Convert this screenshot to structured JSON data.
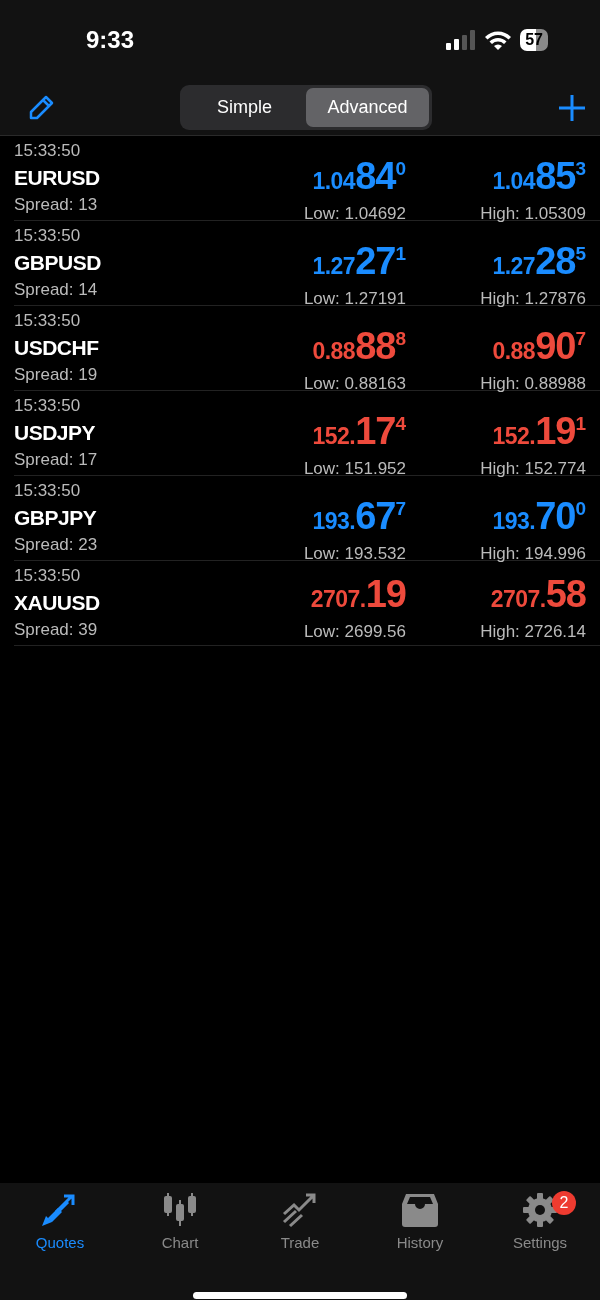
{
  "status_bar": {
    "time": "9:33",
    "battery": "57"
  },
  "header": {
    "segments": [
      {
        "label": "Simple",
        "selected": false
      },
      {
        "label": "Advanced",
        "selected": true
      }
    ]
  },
  "quotes": [
    {
      "time": "15:33:50",
      "symbol": "EURUSD",
      "spread": "Spread: 13",
      "color": "#1a8cff",
      "bid": {
        "prefix": "1.04",
        "big": "84",
        "pip": "0"
      },
      "ask": {
        "prefix": "1.04",
        "big": "85",
        "pip": "3"
      },
      "low": "Low: 1.04692",
      "high": "High: 1.05309"
    },
    {
      "time": "15:33:50",
      "symbol": "GBPUSD",
      "spread": "Spread: 14",
      "color": "#1a8cff",
      "bid": {
        "prefix": "1.27",
        "big": "27",
        "pip": "1"
      },
      "ask": {
        "prefix": "1.27",
        "big": "28",
        "pip": "5"
      },
      "low": "Low: 1.27191",
      "high": "High: 1.27876"
    },
    {
      "time": "15:33:50",
      "symbol": "USDCHF",
      "spread": "Spread: 19",
      "color": "#ee4a3c",
      "bid": {
        "prefix": "0.88",
        "big": "88",
        "pip": "8"
      },
      "ask": {
        "prefix": "0.88",
        "big": "90",
        "pip": "7"
      },
      "low": "Low: 0.88163",
      "high": "High: 0.88988"
    },
    {
      "time": "15:33:50",
      "symbol": "USDJPY",
      "spread": "Spread: 17",
      "color": "#ee4a3c",
      "bid": {
        "prefix": "152.",
        "big": "17",
        "pip": "4"
      },
      "ask": {
        "prefix": "152.",
        "big": "19",
        "pip": "1"
      },
      "low": "Low: 151.952",
      "high": "High: 152.774"
    },
    {
      "time": "15:33:50",
      "symbol": "GBPJPY",
      "spread": "Spread: 23",
      "color": "#1a8cff",
      "bid": {
        "prefix": "193.",
        "big": "67",
        "pip": "7"
      },
      "ask": {
        "prefix": "193.",
        "big": "70",
        "pip": "0"
      },
      "low": "Low: 193.532",
      "high": "High: 194.996"
    },
    {
      "time": "15:33:50",
      "symbol": "XAUUSD",
      "spread": "Spread: 39",
      "color": "#ee4a3c",
      "bid": {
        "prefix": "2707.",
        "big": "19"
      },
      "ask": {
        "prefix": "2707.",
        "big": "58"
      },
      "low": "Low: 2699.56",
      "high": "High: 2726.14"
    }
  ],
  "tab_bar": [
    {
      "kind": "quotes",
      "label": "Quotes",
      "selected": true
    },
    {
      "kind": "chart",
      "label": "Chart",
      "selected": false
    },
    {
      "kind": "trade",
      "label": "Trade",
      "selected": false
    },
    {
      "kind": "history",
      "label": "History",
      "selected": false
    },
    {
      "kind": "settings",
      "label": "Settings",
      "selected": false,
      "badge": "2"
    }
  ]
}
